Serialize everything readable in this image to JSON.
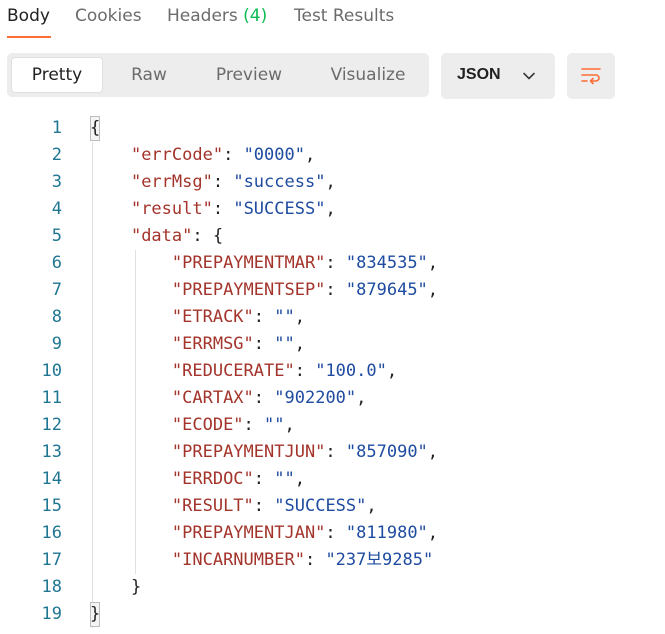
{
  "tabs": {
    "body": "Body",
    "cookies": "Cookies",
    "headers": "Headers",
    "headers_count": "(4)",
    "test_results": "Test Results"
  },
  "view_modes": {
    "pretty": "Pretty",
    "raw": "Raw",
    "preview": "Preview",
    "visualize": "Visualize"
  },
  "format_select": {
    "selected": "JSON"
  },
  "icons": {
    "chevron": "chevron-down-icon",
    "wrap": "wrap-lines-icon"
  },
  "colors": {
    "accent": "#ff6c37",
    "count": "#0cbb52",
    "key": "#a3342b",
    "string": "#1f4ca0",
    "line_number": "#1f7693"
  },
  "code_lines": [
    {
      "n": "1",
      "parts": [
        {
          "t": "{",
          "c": "punc"
        }
      ]
    },
    {
      "n": "2",
      "parts": [
        {
          "t": "    ",
          "c": "punc"
        },
        {
          "t": "\"errCode\"",
          "c": "key"
        },
        {
          "t": ": ",
          "c": "punc"
        },
        {
          "t": "\"0000\"",
          "c": "str"
        },
        {
          "t": ",",
          "c": "punc"
        }
      ]
    },
    {
      "n": "3",
      "parts": [
        {
          "t": "    ",
          "c": "punc"
        },
        {
          "t": "\"errMsg\"",
          "c": "key"
        },
        {
          "t": ": ",
          "c": "punc"
        },
        {
          "t": "\"success\"",
          "c": "str"
        },
        {
          "t": ",",
          "c": "punc"
        }
      ]
    },
    {
      "n": "4",
      "parts": [
        {
          "t": "    ",
          "c": "punc"
        },
        {
          "t": "\"result\"",
          "c": "key"
        },
        {
          "t": ": ",
          "c": "punc"
        },
        {
          "t": "\"SUCCESS\"",
          "c": "str"
        },
        {
          "t": ",",
          "c": "punc"
        }
      ]
    },
    {
      "n": "5",
      "parts": [
        {
          "t": "    ",
          "c": "punc"
        },
        {
          "t": "\"data\"",
          "c": "key"
        },
        {
          "t": ": {",
          "c": "punc"
        }
      ]
    },
    {
      "n": "6",
      "parts": [
        {
          "t": "        ",
          "c": "punc"
        },
        {
          "t": "\"PREPAYMENTMAR\"",
          "c": "key"
        },
        {
          "t": ": ",
          "c": "punc"
        },
        {
          "t": "\"834535\"",
          "c": "str"
        },
        {
          "t": ",",
          "c": "punc"
        }
      ]
    },
    {
      "n": "7",
      "parts": [
        {
          "t": "        ",
          "c": "punc"
        },
        {
          "t": "\"PREPAYMENTSEP\"",
          "c": "key"
        },
        {
          "t": ": ",
          "c": "punc"
        },
        {
          "t": "\"879645\"",
          "c": "str"
        },
        {
          "t": ",",
          "c": "punc"
        }
      ]
    },
    {
      "n": "8",
      "parts": [
        {
          "t": "        ",
          "c": "punc"
        },
        {
          "t": "\"ETRACK\"",
          "c": "key"
        },
        {
          "t": ": ",
          "c": "punc"
        },
        {
          "t": "\"\"",
          "c": "str"
        },
        {
          "t": ",",
          "c": "punc"
        }
      ]
    },
    {
      "n": "9",
      "parts": [
        {
          "t": "        ",
          "c": "punc"
        },
        {
          "t": "\"ERRMSG\"",
          "c": "key"
        },
        {
          "t": ": ",
          "c": "punc"
        },
        {
          "t": "\"\"",
          "c": "str"
        },
        {
          "t": ",",
          "c": "punc"
        }
      ]
    },
    {
      "n": "10",
      "parts": [
        {
          "t": "        ",
          "c": "punc"
        },
        {
          "t": "\"REDUCERATE\"",
          "c": "key"
        },
        {
          "t": ": ",
          "c": "punc"
        },
        {
          "t": "\"100.0\"",
          "c": "str"
        },
        {
          "t": ",",
          "c": "punc"
        }
      ]
    },
    {
      "n": "11",
      "parts": [
        {
          "t": "        ",
          "c": "punc"
        },
        {
          "t": "\"CARTAX\"",
          "c": "key"
        },
        {
          "t": ": ",
          "c": "punc"
        },
        {
          "t": "\"902200\"",
          "c": "str"
        },
        {
          "t": ",",
          "c": "punc"
        }
      ]
    },
    {
      "n": "12",
      "parts": [
        {
          "t": "        ",
          "c": "punc"
        },
        {
          "t": "\"ECODE\"",
          "c": "key"
        },
        {
          "t": ": ",
          "c": "punc"
        },
        {
          "t": "\"\"",
          "c": "str"
        },
        {
          "t": ",",
          "c": "punc"
        }
      ]
    },
    {
      "n": "13",
      "parts": [
        {
          "t": "        ",
          "c": "punc"
        },
        {
          "t": "\"PREPAYMENTJUN\"",
          "c": "key"
        },
        {
          "t": ": ",
          "c": "punc"
        },
        {
          "t": "\"857090\"",
          "c": "str"
        },
        {
          "t": ",",
          "c": "punc"
        }
      ]
    },
    {
      "n": "14",
      "parts": [
        {
          "t": "        ",
          "c": "punc"
        },
        {
          "t": "\"ERRDOC\"",
          "c": "key"
        },
        {
          "t": ": ",
          "c": "punc"
        },
        {
          "t": "\"\"",
          "c": "str"
        },
        {
          "t": ",",
          "c": "punc"
        }
      ]
    },
    {
      "n": "15",
      "parts": [
        {
          "t": "        ",
          "c": "punc"
        },
        {
          "t": "\"RESULT\"",
          "c": "key"
        },
        {
          "t": ": ",
          "c": "punc"
        },
        {
          "t": "\"SUCCESS\"",
          "c": "str"
        },
        {
          "t": ",",
          "c": "punc"
        }
      ]
    },
    {
      "n": "16",
      "parts": [
        {
          "t": "        ",
          "c": "punc"
        },
        {
          "t": "\"PREPAYMENTJAN\"",
          "c": "key"
        },
        {
          "t": ": ",
          "c": "punc"
        },
        {
          "t": "\"811980\"",
          "c": "str"
        },
        {
          "t": ",",
          "c": "punc"
        }
      ]
    },
    {
      "n": "17",
      "parts": [
        {
          "t": "        ",
          "c": "punc"
        },
        {
          "t": "\"INCARNUMBER\"",
          "c": "key"
        },
        {
          "t": ": ",
          "c": "punc"
        },
        {
          "t": "\"237보9285\"",
          "c": "str"
        }
      ]
    },
    {
      "n": "18",
      "parts": [
        {
          "t": "    ",
          "c": "punc"
        },
        {
          "t": "}",
          "c": "punc"
        }
      ]
    },
    {
      "n": "19",
      "parts": [
        {
          "t": "}",
          "c": "punc"
        }
      ]
    }
  ]
}
